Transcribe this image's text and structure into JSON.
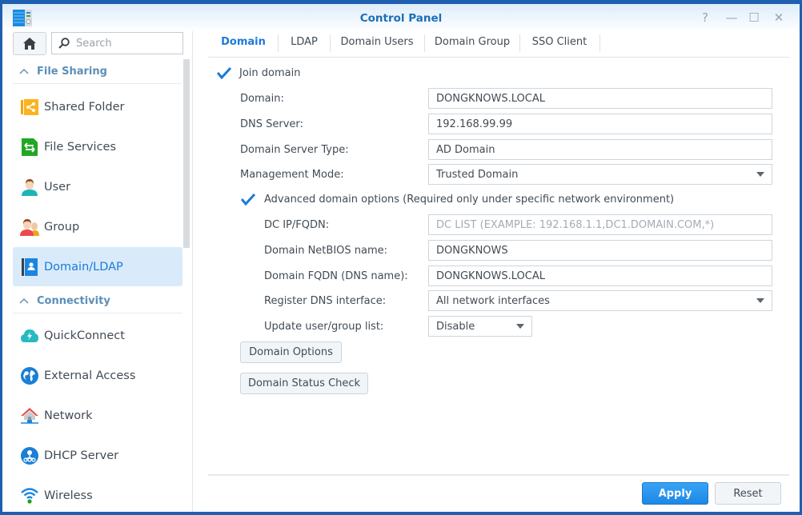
{
  "window": {
    "title": "Control Panel",
    "controls": {
      "help": "?",
      "minimize": "—",
      "maximize": "☐",
      "close": "✕"
    }
  },
  "sidebar": {
    "search_placeholder": "Search",
    "groups": [
      {
        "label": "File Sharing",
        "items": [
          {
            "label": "Shared Folder",
            "icon": "shared-folder-icon"
          },
          {
            "label": "File Services",
            "icon": "file-services-icon"
          },
          {
            "label": "User",
            "icon": "user-icon"
          },
          {
            "label": "Group",
            "icon": "group-icon"
          },
          {
            "label": "Domain/LDAP",
            "icon": "domain-ldap-icon",
            "active": true
          }
        ]
      },
      {
        "label": "Connectivity",
        "items": [
          {
            "label": "QuickConnect",
            "icon": "quickconnect-icon"
          },
          {
            "label": "External Access",
            "icon": "external-access-icon"
          },
          {
            "label": "Network",
            "icon": "network-icon"
          },
          {
            "label": "DHCP Server",
            "icon": "dhcp-server-icon"
          },
          {
            "label": "Wireless",
            "icon": "wireless-icon"
          }
        ]
      }
    ]
  },
  "tabs": [
    {
      "label": "Domain",
      "active": true
    },
    {
      "label": "LDAP"
    },
    {
      "label": "Domain Users"
    },
    {
      "label": "Domain Group"
    },
    {
      "label": "SSO Client"
    }
  ],
  "form": {
    "join_domain": {
      "label": "Join domain",
      "checked": true
    },
    "domain": {
      "label": "Domain:",
      "value": "DONGKNOWS.LOCAL"
    },
    "dns_server": {
      "label": "DNS Server:",
      "value": "192.168.99.99"
    },
    "server_type": {
      "label": "Domain Server Type:",
      "value": "AD Domain"
    },
    "management_mode": {
      "label": "Management Mode:",
      "value": "Trusted Domain"
    },
    "advanced": {
      "label": "Advanced domain options (Required only under specific network environment)",
      "checked": true
    },
    "dc_ip": {
      "label": "DC IP/FQDN:",
      "value": "",
      "placeholder": "DC LIST (EXAMPLE: 192.168.1.1,DC1.DOMAIN.COM,*)"
    },
    "netbios": {
      "label": "Domain NetBIOS name:",
      "value": "DONGKNOWS"
    },
    "fqdn": {
      "label": "Domain FQDN (DNS name):",
      "value": "DONGKNOWS.LOCAL"
    },
    "register_dns": {
      "label": "Register DNS interface:",
      "value": "All network interfaces"
    },
    "update_list": {
      "label": "Update user/group list:",
      "value": "Disable"
    },
    "domain_options_btn": "Domain Options",
    "status_check_btn": "Domain Status Check"
  },
  "footer": {
    "apply": "Apply",
    "reset": "Reset"
  },
  "colors": {
    "accent": "#1c7ad8",
    "window_border": "#1f5fb0",
    "active_bg": "#d9ebfb"
  }
}
